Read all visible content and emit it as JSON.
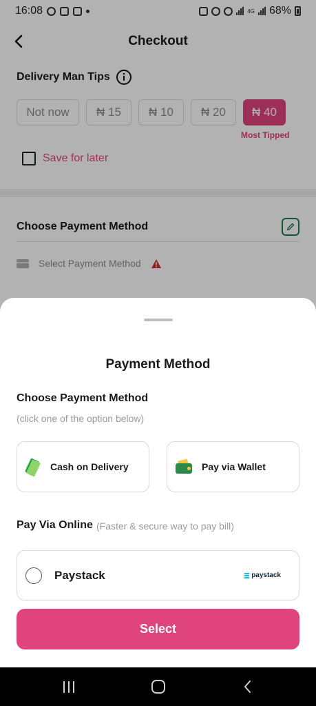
{
  "status_bar": {
    "time": "16:08",
    "battery": "68%",
    "network": "4G"
  },
  "header": {
    "title": "Checkout",
    "back_icon": "chevron-left-icon"
  },
  "tips": {
    "title": "Delivery Man Tips",
    "options": [
      "Not now",
      "₦ 15",
      "₦ 10",
      "₦ 20",
      "₦ 40"
    ],
    "selected_index": 4,
    "most_tipped_label": "Most Tipped",
    "save_label": "Save for later"
  },
  "payment_section": {
    "title": "Choose Payment Method",
    "select_placeholder": "Select Payment Method"
  },
  "sheet": {
    "title": "Payment Method",
    "choose_title": "Choose Payment Method",
    "choose_hint": "(click one of the option below)",
    "options": [
      {
        "label": "Cash on Delivery",
        "icon": "cash-icon"
      },
      {
        "label": "Pay via Wallet",
        "icon": "wallet-icon"
      }
    ],
    "online_title": "Pay Via Online",
    "online_hint": "(Faster & secure way to pay bill)",
    "online_option": {
      "label": "Paystack",
      "logo_text": "paystack"
    },
    "select_button": "Select"
  },
  "colors": {
    "accent": "#e0447c",
    "edit_green": "#1d7a53",
    "warning": "#d32f2f"
  }
}
